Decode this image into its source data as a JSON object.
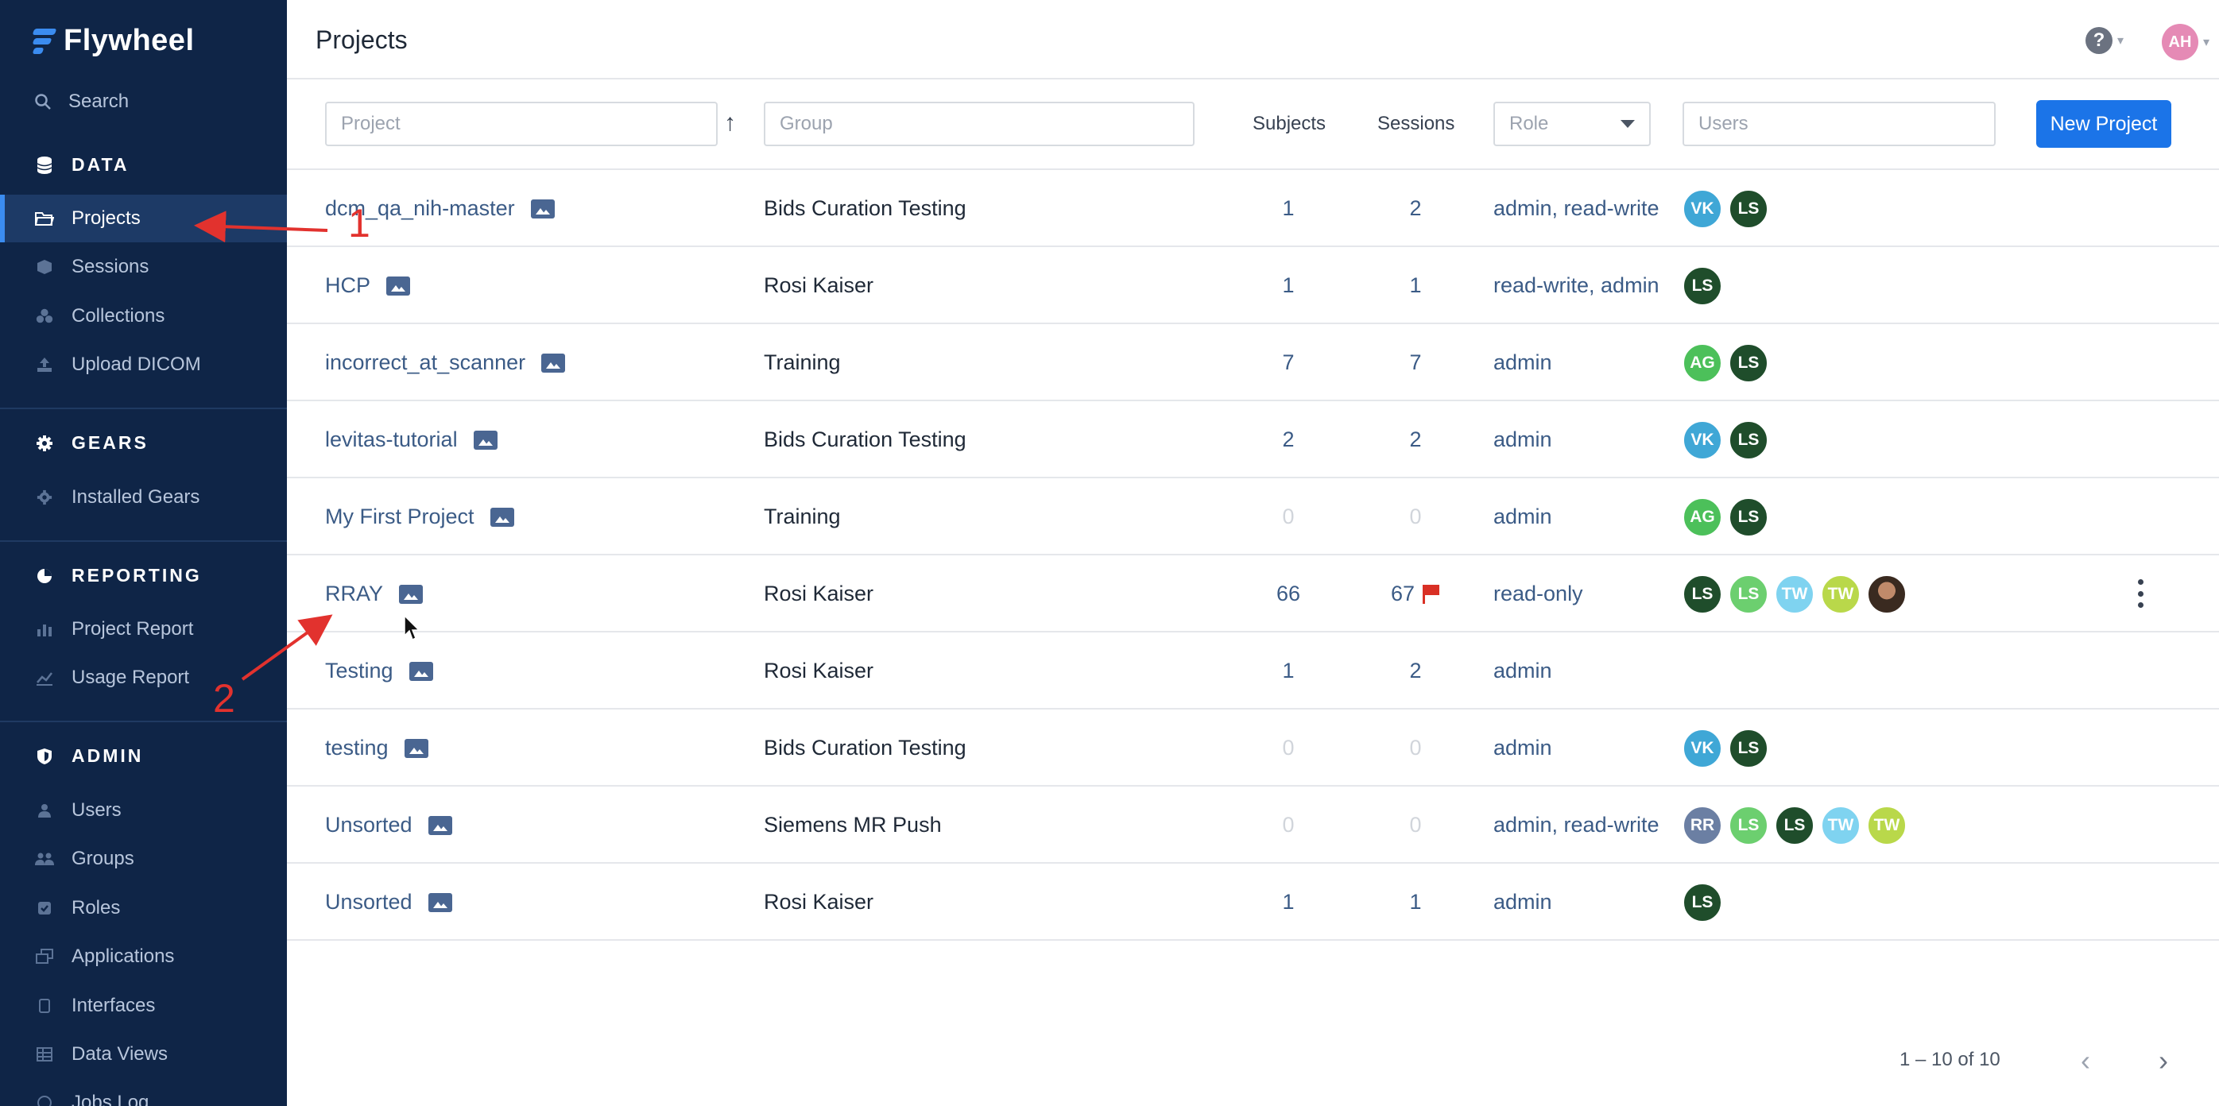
{
  "app": {
    "brand": "Flywheel"
  },
  "sidebar": {
    "search_label": "Search",
    "sections": {
      "data": "DATA",
      "gears": "GEARS",
      "reporting": "REPORTING",
      "admin": "ADMIN"
    },
    "items": [
      {
        "label": "Projects",
        "icon": "folder-icon"
      },
      {
        "label": "Sessions",
        "icon": "cube-icon"
      },
      {
        "label": "Collections",
        "icon": "collections-icon"
      },
      {
        "label": "Upload DICOM",
        "icon": "upload-icon"
      },
      {
        "label": "Installed Gears",
        "icon": "gear-icon"
      },
      {
        "label": "Project Report",
        "icon": "bar-chart-icon"
      },
      {
        "label": "Usage Report",
        "icon": "line-chart-icon"
      },
      {
        "label": "Users",
        "icon": "user-icon"
      },
      {
        "label": "Groups",
        "icon": "group-icon"
      },
      {
        "label": "Roles",
        "icon": "roles-icon"
      },
      {
        "label": "Applications",
        "icon": "applications-icon"
      },
      {
        "label": "Interfaces",
        "icon": "interfaces-icon"
      },
      {
        "label": "Data Views",
        "icon": "table-icon"
      },
      {
        "label": "Jobs Log",
        "icon": "jobs-icon"
      }
    ]
  },
  "header": {
    "title": "Projects",
    "help_symbol": "?",
    "user_initials": "AH"
  },
  "filters": {
    "project_placeholder": "Project",
    "group_placeholder": "Group",
    "subjects_header": "Subjects",
    "sessions_header": "Sessions",
    "role_placeholder": "Role",
    "users_placeholder": "Users",
    "new_project_label": "New Project"
  },
  "rows": [
    {
      "project": "dcm_qa_nih-master",
      "group": "Bids Curation Testing",
      "subjects": "1",
      "sessions": "2",
      "role": "admin, read-write",
      "users": [
        "VK",
        "LS"
      ]
    },
    {
      "project": "HCP",
      "group": "Rosi Kaiser",
      "subjects": "1",
      "sessions": "1",
      "role": "read-write, admin",
      "users": [
        "LS"
      ]
    },
    {
      "project": "incorrect_at_scanner",
      "group": "Training",
      "subjects": "7",
      "sessions": "7",
      "role": "admin",
      "users": [
        "AG",
        "LS"
      ]
    },
    {
      "project": "levitas-tutorial",
      "group": "Bids Curation Testing",
      "subjects": "2",
      "sessions": "2",
      "role": "admin",
      "users": [
        "VK",
        "LS"
      ]
    },
    {
      "project": "My First Project",
      "group": "Training",
      "subjects": "0",
      "sessions": "0",
      "role": "admin",
      "users": [
        "AG",
        "LS"
      ]
    },
    {
      "project": "RRAY",
      "group": "Rosi Kaiser",
      "subjects": "66",
      "sessions": "67",
      "role": "read-only",
      "users": [
        "LS",
        "LS",
        "TW",
        "TW"
      ]
    },
    {
      "project": "Testing",
      "group": "Rosi Kaiser",
      "subjects": "1",
      "sessions": "2",
      "role": "admin",
      "users": []
    },
    {
      "project": "testing",
      "group": "Bids Curation Testing",
      "subjects": "0",
      "sessions": "0",
      "role": "admin",
      "users": [
        "VK",
        "LS"
      ]
    },
    {
      "project": "Unsorted",
      "group": "Siemens MR Push",
      "subjects": "0",
      "sessions": "0",
      "role": "admin, read-write",
      "users": [
        "RR",
        "LS",
        "LS",
        "TW",
        "TW"
      ]
    },
    {
      "project": "Unsorted",
      "group": "Rosi Kaiser",
      "subjects": "1",
      "sessions": "1",
      "role": "admin",
      "users": [
        "LS"
      ]
    }
  ],
  "avatar_colors": {
    "VK": "#3fa7d6",
    "LS_dark": "#1f4d2b",
    "LS_light": "#6ccf6f",
    "AG": "#4cc05a",
    "TW_blue": "#7fd3f0",
    "TW_lime": "#b9d84a",
    "RR": "#6b7fa3"
  },
  "pagination": {
    "range": "1 – 10 of 10",
    "prev_symbol": "‹",
    "next_symbol": "›"
  },
  "annotations": {
    "label_1": "1",
    "label_2": "2",
    "color": "#e2322e"
  }
}
